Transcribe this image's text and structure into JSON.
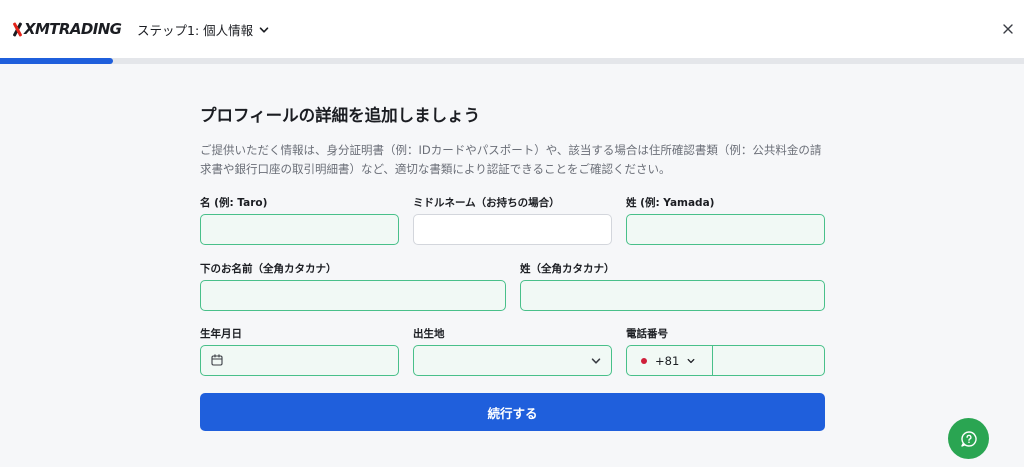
{
  "header": {
    "logo_text": "XMTRADING",
    "step_label": "ステップ1: 個人情報",
    "progress": 0.11
  },
  "form": {
    "title": "プロフィールの詳細を追加しましょう",
    "description": "ご提供いただく情報は、身分証明書（例：IDカードやパスポート）や、該当する場合は住所確認書類（例：公共料金の請求書や銀行口座の取引明細書）など、適切な書類により認証できることをご確認ください。",
    "first_name": {
      "label": "名 (例: Taro)",
      "value": ""
    },
    "middle_name": {
      "label": "ミドルネーム（お持ちの場合）",
      "value": ""
    },
    "last_name": {
      "label": "姓 (例: Yamada)",
      "value": ""
    },
    "first_name_kana": {
      "label": "下のお名前（全角カタカナ）",
      "value": ""
    },
    "last_name_kana": {
      "label": "姓（全角カタカナ）",
      "value": ""
    },
    "birth_date": {
      "label": "生年月日",
      "value": ""
    },
    "birth_place": {
      "label": "出生地",
      "value": ""
    },
    "phone": {
      "label": "電話番号",
      "country_code": "+81",
      "number": ""
    },
    "submit_label": "続行する"
  },
  "colors": {
    "accent": "#1f5fdc",
    "valid_border": "#49c08a",
    "help_button": "#2aa552"
  }
}
